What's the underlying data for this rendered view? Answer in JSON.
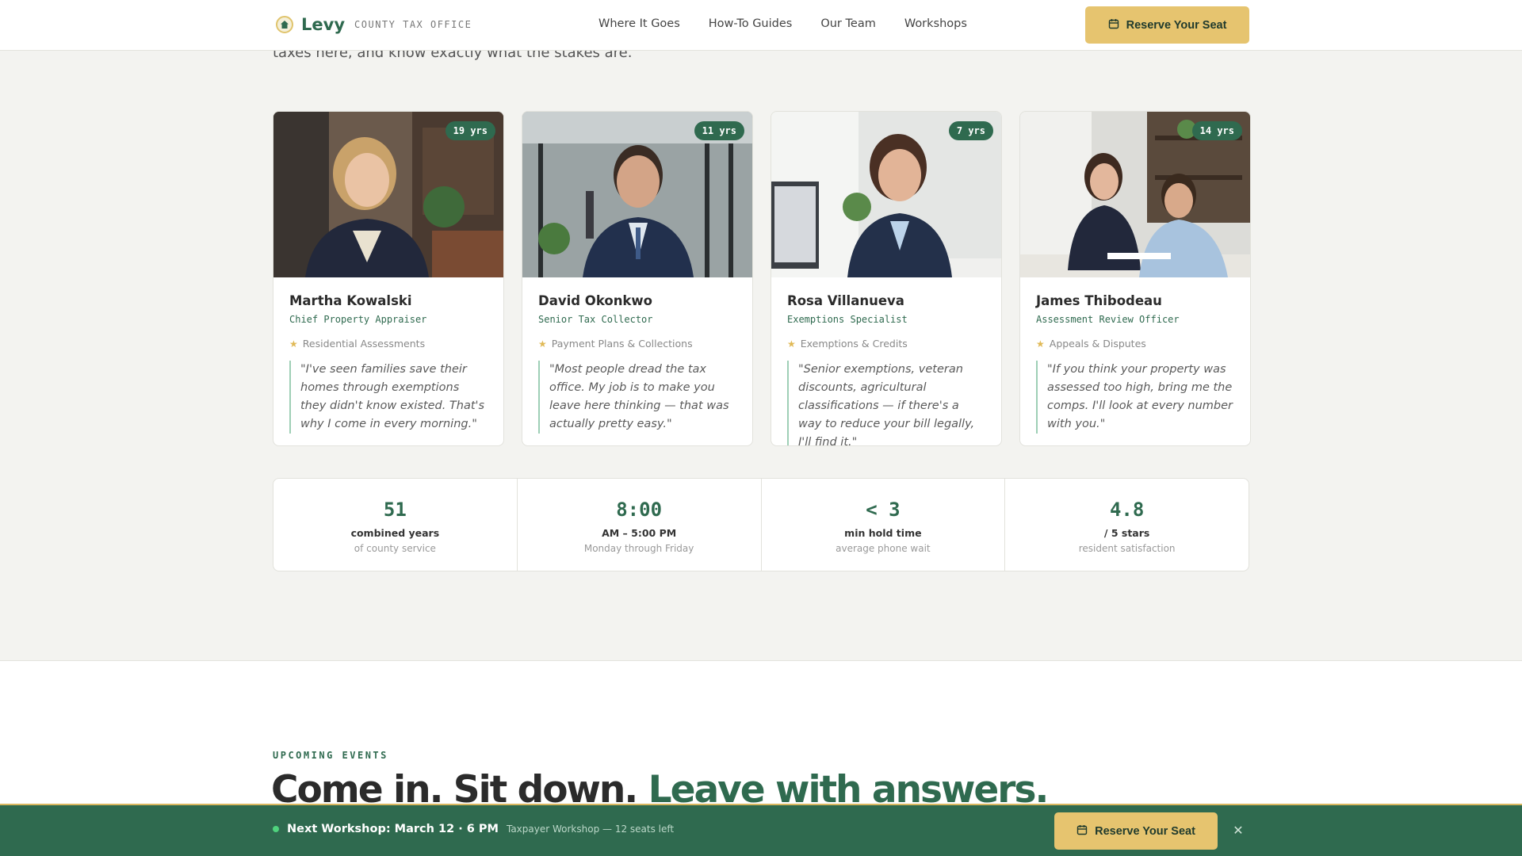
{
  "header": {
    "brand_name": "Levy",
    "brand_sub": "COUNTY TAX OFFICE",
    "nav": [
      "Where It Goes",
      "How-To Guides",
      "Our Team",
      "Workshops"
    ],
    "cta_label": "Reserve Your Seat"
  },
  "intro_text": "taxes here, and know exactly what the stakes are.",
  "team": [
    {
      "years": "19 yrs",
      "name": "Martha Kowalski",
      "role": "Chief Property Appraiser",
      "specialty": "Residential Assessments",
      "quote": "\"I've seen families save their homes through exemptions they didn't know existed. That's why I come in every morning.\""
    },
    {
      "years": "11 yrs",
      "name": "David Okonkwo",
      "role": "Senior Tax Collector",
      "specialty": "Payment Plans & Collections",
      "quote": "\"Most people dread the tax office. My job is to make you leave here thinking — that was actually pretty easy.\""
    },
    {
      "years": "7 yrs",
      "name": "Rosa Villanueva",
      "role": "Exemptions Specialist",
      "specialty": "Exemptions & Credits",
      "quote": "\"Senior exemptions, veteran discounts, agricultural classifications — if there's a way to reduce your bill legally, I'll find it.\""
    },
    {
      "years": "14 yrs",
      "name": "James Thibodeau",
      "role": "Assessment Review Officer",
      "specialty": "Appeals & Disputes",
      "quote": "\"If you think your property was assessed too high, bring me the comps. I'll look at every number with you.\""
    }
  ],
  "stats": [
    {
      "value": "51",
      "label": "combined years",
      "sub": "of county service"
    },
    {
      "value": "8:00",
      "label": "AM – 5:00 PM",
      "sub": "Monday through Friday"
    },
    {
      "value": "< 3",
      "label": "min hold time",
      "sub": "average phone wait"
    },
    {
      "value": "4.8",
      "label": "/ 5 stars",
      "sub": "resident satisfaction"
    }
  ],
  "events": {
    "eyebrow": "UPCOMING EVENTS",
    "title_main": "Come in. Sit down.",
    "title_accent": "Leave with answers."
  },
  "bottom_bar": {
    "title": "Next Workshop: March 12 · 6 PM",
    "sub": "Taxpayer Workshop — 12 seats left",
    "cta_label": "Reserve Your Seat"
  },
  "icons": {
    "brand": "house-icon",
    "cta": "calendar-icon",
    "close": "close-icon",
    "star": "star-icon"
  },
  "colors": {
    "primary": "#2f6a4f",
    "accent": "#e6c46f",
    "background": "#f3f3f0"
  }
}
